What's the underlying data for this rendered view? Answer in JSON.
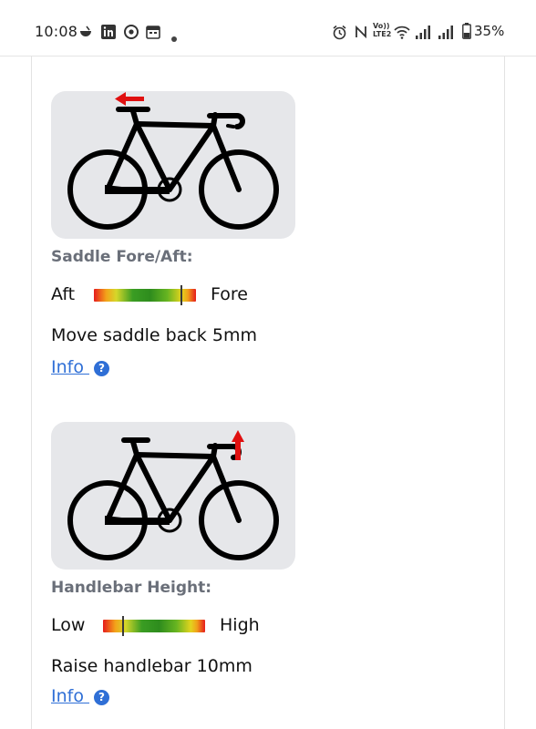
{
  "status_bar": {
    "time": "10:08",
    "battery": "35%",
    "network_label": "Vo)) LTE2",
    "left_icons": [
      "bowl-icon",
      "linkedin-icon",
      "chrome-icon",
      "calendar-icon",
      "dot-icon"
    ],
    "right_icons": [
      "alarm-icon",
      "nfc-icon",
      "volte-icon",
      "wifi-icon",
      "signal-icon",
      "signal-icon",
      "battery-icon"
    ]
  },
  "sections": [
    {
      "label": "Saddle Fore/Aft:",
      "scale_left": "Aft",
      "scale_right": "Fore",
      "needle_position": 0.86,
      "advice": "Move saddle back 5mm",
      "info_label": "Info",
      "arrow_direction": "left",
      "arrow_target": "saddle"
    },
    {
      "label": "Handlebar Height:",
      "scale_left": "Low",
      "scale_right": "High",
      "needle_position": 0.2,
      "advice": "Raise handlebar 10mm",
      "info_label": "Info",
      "arrow_direction": "up",
      "arrow_target": "handlebar"
    }
  ],
  "colors": {
    "link": "#2f6fd6",
    "image_bg": "#e6e7ea",
    "arrow": "#e01010",
    "label": "#6a6f79"
  }
}
